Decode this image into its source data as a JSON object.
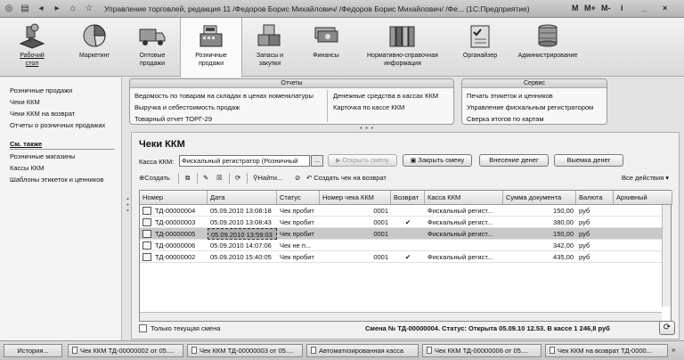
{
  "window": {
    "title": "Управление торговлей, редакция 11 /Федоров Борис Михайлович/ /Федоров Борис Михайлович/ /Фе... (1С:Предприятие)",
    "controls": [
      "M",
      "M+",
      "M-",
      "i",
      "_",
      "×"
    ]
  },
  "sections": [
    {
      "label": "Рабочий\nстол",
      "icon": "desktop-icon"
    },
    {
      "label": "Маркетинг",
      "icon": "pie-chart-icon"
    },
    {
      "label": "Оптовые\nпродажи",
      "icon": "truck-icon"
    },
    {
      "label": "Розничные\nпродажи",
      "icon": "cash-register-icon"
    },
    {
      "label": "Запасы и\nзакупки",
      "icon": "boxes-icon"
    },
    {
      "label": "Финансы",
      "icon": "money-icon"
    },
    {
      "label": "Нормативно-справочная\nинформация",
      "icon": "books-icon"
    },
    {
      "label": "Органайзер",
      "icon": "organizer-icon"
    },
    {
      "label": "Администрирование",
      "icon": "server-icon"
    }
  ],
  "left_nav": {
    "items": [
      "Розничные продажи",
      "Чеки ККМ",
      "Чеки ККМ на возврат",
      "Отчеты о розничных продажах"
    ],
    "see_also_title": "См. также",
    "see_also": [
      "Розничные магазины",
      "Кассы ККМ",
      "Шаблоны этикеток и ценников"
    ]
  },
  "reports_panel": {
    "title": "Отчеты",
    "items": [
      "Ведомость по товарам на складах в ценах номенклатуры",
      "Выручка и себестоимость продаж",
      "Товарный отчет ТОРГ-29",
      "Денежные средства в кассах ККМ",
      "Карточка по кассе ККМ"
    ]
  },
  "service_panel": {
    "title": "Сервис",
    "items": [
      "Печать этикеток и ценников",
      "Управление фискальным регистратором",
      "Сверка итогов по картам"
    ]
  },
  "form": {
    "title": "Чеки ККМ",
    "kassa_label": "Касса ККМ:",
    "kassa_value": "Фискальный регистратор (Розничный",
    "kassa_select": "...",
    "btn_open_shift": "Открыть смену",
    "btn_close_shift": "Закрыть смену",
    "btn_deposit": "Внесение денег",
    "btn_withdraw": "Выемка денег",
    "toolbar": {
      "create": "Создать",
      "find": "Найти...",
      "create_return": "Создать чек на возврат",
      "all_actions": "Все действия"
    },
    "columns": [
      "Номер",
      "Дата",
      "Статус",
      "Номер чека ККМ",
      "Возврат",
      "Касса ККМ",
      "Сумма документа",
      "Валюта",
      "Архивный"
    ],
    "rows": [
      {
        "number": "ТД-00000004",
        "date": "05.09.2010 13:08:18",
        "status": "Чек пробит",
        "check_no": "0001",
        "return": "",
        "kassa": "Фискальный регист...",
        "sum": "150,00",
        "currency": "руб",
        "archive": "",
        "selected": false
      },
      {
        "number": "ТД-00000003",
        "date": "05.09.2010 13:08:43",
        "status": "Чек пробит",
        "check_no": "0001",
        "return": "✔",
        "kassa": "Фискальный регист...",
        "sum": "380,00",
        "currency": "руб",
        "archive": "",
        "selected": false
      },
      {
        "number": "ТД-00000005",
        "date": "05.09.2010 13:59:03",
        "status": "Чек пробит",
        "check_no": "0001",
        "return": "",
        "kassa": "Фискальный регист...",
        "sum": "150,00",
        "currency": "руб",
        "archive": "",
        "selected": true
      },
      {
        "number": "ТД-00000006",
        "date": "05.09.2010 14:07:06",
        "status": "Чек не п...",
        "check_no": "",
        "return": "",
        "kassa": "",
        "sum": "342,00",
        "currency": "руб",
        "archive": "",
        "selected": false
      },
      {
        "number": "ТД-00000002",
        "date": "05.09.2010 15:40:05",
        "status": "Чек пробит",
        "check_no": "0001",
        "return": "✔",
        "kassa": "Фискальный регист...",
        "sum": "435,00",
        "currency": "руб",
        "archive": "",
        "selected": false
      }
    ],
    "only_current_shift": "Только текущая смена",
    "status_line": "Смена № ТД-00000004. Статус: Открыта 05.09.10 12.53. В кассе 1 246,8 руб"
  },
  "taskbar": {
    "history": "История...",
    "tasks": [
      "Чек ККМ ТД-00000002 от 05....",
      "Чек ККМ ТД-00000003 от 05....",
      "Автоматизированная касса",
      "Чек ККМ ТД-00000006 от 05....",
      "Чек ККМ на возврат ТД-0000..."
    ]
  }
}
